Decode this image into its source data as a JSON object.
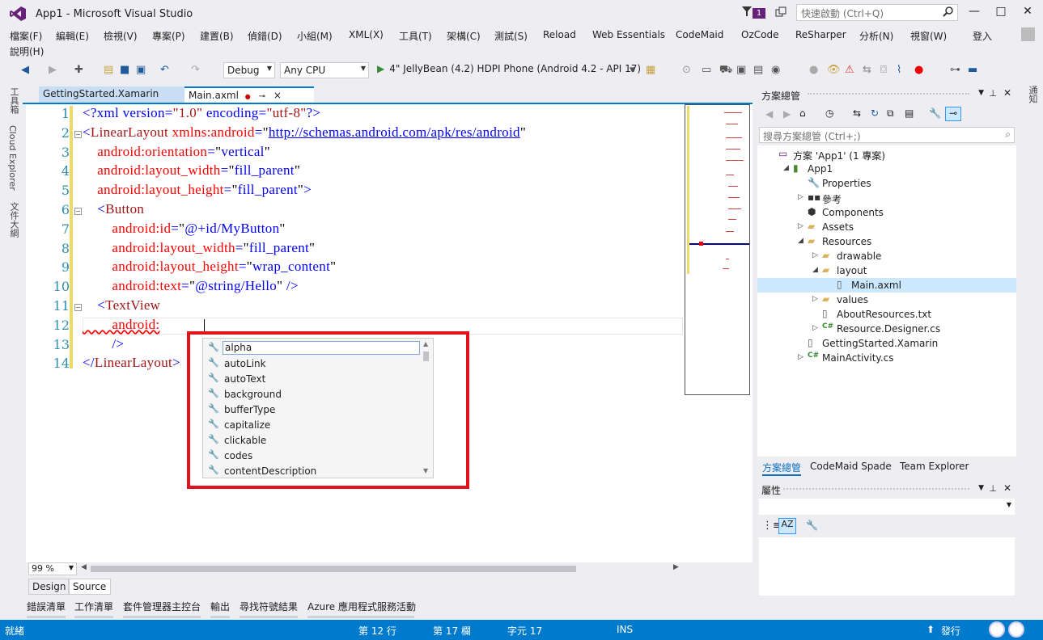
{
  "window": {
    "title": "App1 - Microsoft Visual Studio",
    "notification_count": "1",
    "quick_launch_placeholder": "快速啟動 (Ctrl+Q)",
    "signin": "登入"
  },
  "menu": [
    "檔案(F)",
    "編輯(E)",
    "檢視(V)",
    "專案(P)",
    "建置(B)",
    "偵錯(D)",
    "小組(M)",
    "XML(X)",
    "工具(T)",
    "架構(C)",
    "測試(S)",
    "Reload",
    "Web Essentials",
    "CodeMaid",
    "OzCode",
    "ReSharper",
    "分析(N)",
    "視窗(W)",
    "說明(H)"
  ],
  "toolbar": {
    "config": "Debug",
    "platform": "Any CPU",
    "run_target": "4\" JellyBean (4.2) HDPI Phone (Android 4.2 - API 17)"
  },
  "left_rail": [
    "工具箱",
    "Cloud Explorer",
    "文件大綱"
  ],
  "right_rail": "通知",
  "doc_tabs": [
    {
      "label": "GettingStarted.Xamarin"
    },
    {
      "label": "Main.axml",
      "pin": "⊸",
      "close": "×"
    }
  ],
  "editor": {
    "line_numbers": [
      "1",
      "2",
      "3",
      "4",
      "5",
      "6",
      "7",
      "8",
      "9",
      "10",
      "11",
      "12",
      "13",
      "14"
    ],
    "lines": [
      [
        {
          "t": "<?xml version=",
          "c": "c-blue"
        },
        {
          "t": "\"1.0\"",
          "c": "c-red"
        },
        {
          "t": " encoding=",
          "c": "c-blue"
        },
        {
          "t": "\"utf-8\"",
          "c": "c-red"
        },
        {
          "t": "?>",
          "c": "c-blue"
        }
      ],
      [
        {
          "t": "<",
          "c": "c-blue"
        },
        {
          "t": "LinearLayout",
          "c": "c-red"
        },
        {
          "t": " xmlns:android",
          "c": "c-attr"
        },
        {
          "t": "=",
          "c": "c-blue"
        },
        {
          "t": "\"",
          "c": "c-black"
        },
        {
          "t": "http://schemas.android.com/apk/res/android",
          "c": "c-url"
        },
        {
          "t": "\"",
          "c": "c-black"
        }
      ],
      [
        {
          "t": "    android:orientation",
          "c": "c-attr"
        },
        {
          "t": "=",
          "c": "c-blue"
        },
        {
          "t": "\"",
          "c": "c-black"
        },
        {
          "t": "vertical",
          "c": "c-blue"
        },
        {
          "t": "\"",
          "c": "c-black"
        }
      ],
      [
        {
          "t": "    android:layout_width",
          "c": "c-attr"
        },
        {
          "t": "=",
          "c": "c-blue"
        },
        {
          "t": "\"",
          "c": "c-black"
        },
        {
          "t": "fill_parent",
          "c": "c-blue"
        },
        {
          "t": "\"",
          "c": "c-black"
        }
      ],
      [
        {
          "t": "    android:layout_height",
          "c": "c-attr"
        },
        {
          "t": "=",
          "c": "c-blue"
        },
        {
          "t": "\"",
          "c": "c-black"
        },
        {
          "t": "fill_parent",
          "c": "c-blue"
        },
        {
          "t": "\"",
          "c": "c-black"
        },
        {
          "t": ">",
          "c": "c-blue"
        }
      ],
      [
        {
          "t": "    <",
          "c": "c-blue"
        },
        {
          "t": "Button",
          "c": "c-red"
        }
      ],
      [
        {
          "t": "        android:id",
          "c": "c-attr"
        },
        {
          "t": "=",
          "c": "c-blue"
        },
        {
          "t": "\"",
          "c": "c-black"
        },
        {
          "t": "@+id/MyButton",
          "c": "c-blue"
        },
        {
          "t": "\"",
          "c": "c-black"
        }
      ],
      [
        {
          "t": "        android:layout_width",
          "c": "c-attr"
        },
        {
          "t": "=",
          "c": "c-blue"
        },
        {
          "t": "\"",
          "c": "c-black"
        },
        {
          "t": "fill_parent",
          "c": "c-blue"
        },
        {
          "t": "\"",
          "c": "c-black"
        }
      ],
      [
        {
          "t": "        android:layout_height",
          "c": "c-attr"
        },
        {
          "t": "=",
          "c": "c-blue"
        },
        {
          "t": "\"",
          "c": "c-black"
        },
        {
          "t": "wrap_content",
          "c": "c-blue"
        },
        {
          "t": "\"",
          "c": "c-black"
        }
      ],
      [
        {
          "t": "        android:text",
          "c": "c-attr"
        },
        {
          "t": "=",
          "c": "c-blue"
        },
        {
          "t": "\"",
          "c": "c-black"
        },
        {
          "t": "@string/Hello",
          "c": "c-blue"
        },
        {
          "t": "\"",
          "c": "c-black"
        },
        {
          "t": " />",
          "c": "c-blue"
        }
      ],
      [
        {
          "t": "    <",
          "c": "c-blue"
        },
        {
          "t": "TextView",
          "c": "c-red"
        }
      ],
      [
        {
          "t": "        android:",
          "c": "c-attr squiggle"
        }
      ],
      [
        {
          "t": "        />",
          "c": "c-blue"
        }
      ],
      [
        {
          "t": "</",
          "c": "c-blue"
        },
        {
          "t": "LinearLayout",
          "c": "c-red"
        },
        {
          "t": ">",
          "c": "c-blue"
        }
      ]
    ],
    "zoom": "99 %",
    "view_tabs": [
      "Design",
      "Source"
    ]
  },
  "completion": [
    "alpha",
    "autoLink",
    "autoText",
    "background",
    "bufferType",
    "capitalize",
    "clickable",
    "codes",
    "contentDescription"
  ],
  "solution_explorer": {
    "title": "方案總管",
    "search_placeholder": "搜尋方案總管 (Ctrl+;)",
    "tree": [
      {
        "label": "方案 'App1' (1 專案)",
        "icon": "solution-icon"
      },
      {
        "label": "App1",
        "icon": "android-project-icon",
        "expanded": true
      },
      {
        "label": "Properties",
        "icon": "wrench-icon"
      },
      {
        "label": "參考",
        "icon": "references-icon"
      },
      {
        "label": "Components",
        "icon": "components-icon"
      },
      {
        "label": "Assets",
        "icon": "folder-icon"
      },
      {
        "label": "Resources",
        "icon": "folder-icon",
        "expanded": true
      },
      {
        "label": "drawable",
        "icon": "folder-icon"
      },
      {
        "label": "layout",
        "icon": "folder-icon",
        "expanded": true
      },
      {
        "label": "Main.axml",
        "icon": "file-icon"
      },
      {
        "label": "values",
        "icon": "folder-icon"
      },
      {
        "label": "AboutResources.txt",
        "icon": "file-icon"
      },
      {
        "label": "Resource.Designer.cs",
        "icon": "csharp-icon"
      },
      {
        "label": "GettingStarted.Xamarin",
        "icon": "file-icon"
      },
      {
        "label": "MainActivity.cs",
        "icon": "csharp-icon"
      }
    ],
    "tabs": [
      "方案總管",
      "CodeMaid Spade",
      "Team Explorer"
    ]
  },
  "properties": {
    "title": "屬性"
  },
  "bottom_tabs": [
    "錯誤清單",
    "工作清單",
    "套件管理器主控台",
    "輸出",
    "尋找符號結果",
    "Azure 應用程式服務活動"
  ],
  "status": {
    "ready": "就緒",
    "line": "第 12 行",
    "col": "第 17 欄",
    "ch": "字元 17",
    "ins": "INS",
    "publish": "發行"
  },
  "colors": {
    "accent": "#007acc",
    "vs_purple": "#68217a",
    "highlight_box": "#e1121c"
  }
}
